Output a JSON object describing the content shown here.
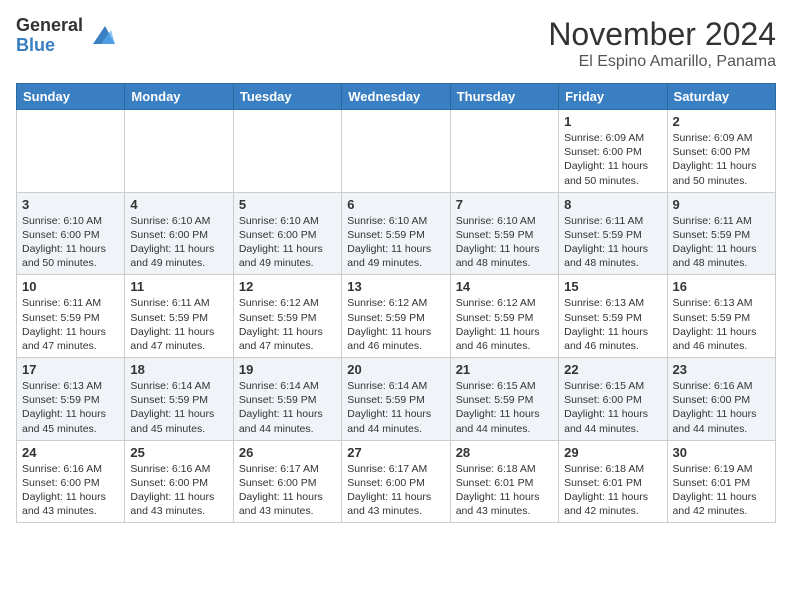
{
  "logo": {
    "general": "General",
    "blue": "Blue"
  },
  "title": "November 2024",
  "location": "El Espino Amarillo, Panama",
  "days_header": [
    "Sunday",
    "Monday",
    "Tuesday",
    "Wednesday",
    "Thursday",
    "Friday",
    "Saturday"
  ],
  "weeks": [
    [
      {
        "day": "",
        "text": ""
      },
      {
        "day": "",
        "text": ""
      },
      {
        "day": "",
        "text": ""
      },
      {
        "day": "",
        "text": ""
      },
      {
        "day": "",
        "text": ""
      },
      {
        "day": "1",
        "text": "Sunrise: 6:09 AM\nSunset: 6:00 PM\nDaylight: 11 hours\nand 50 minutes."
      },
      {
        "day": "2",
        "text": "Sunrise: 6:09 AM\nSunset: 6:00 PM\nDaylight: 11 hours\nand 50 minutes."
      }
    ],
    [
      {
        "day": "3",
        "text": "Sunrise: 6:10 AM\nSunset: 6:00 PM\nDaylight: 11 hours\nand 50 minutes."
      },
      {
        "day": "4",
        "text": "Sunrise: 6:10 AM\nSunset: 6:00 PM\nDaylight: 11 hours\nand 49 minutes."
      },
      {
        "day": "5",
        "text": "Sunrise: 6:10 AM\nSunset: 6:00 PM\nDaylight: 11 hours\nand 49 minutes."
      },
      {
        "day": "6",
        "text": "Sunrise: 6:10 AM\nSunset: 5:59 PM\nDaylight: 11 hours\nand 49 minutes."
      },
      {
        "day": "7",
        "text": "Sunrise: 6:10 AM\nSunset: 5:59 PM\nDaylight: 11 hours\nand 48 minutes."
      },
      {
        "day": "8",
        "text": "Sunrise: 6:11 AM\nSunset: 5:59 PM\nDaylight: 11 hours\nand 48 minutes."
      },
      {
        "day": "9",
        "text": "Sunrise: 6:11 AM\nSunset: 5:59 PM\nDaylight: 11 hours\nand 48 minutes."
      }
    ],
    [
      {
        "day": "10",
        "text": "Sunrise: 6:11 AM\nSunset: 5:59 PM\nDaylight: 11 hours\nand 47 minutes."
      },
      {
        "day": "11",
        "text": "Sunrise: 6:11 AM\nSunset: 5:59 PM\nDaylight: 11 hours\nand 47 minutes."
      },
      {
        "day": "12",
        "text": "Sunrise: 6:12 AM\nSunset: 5:59 PM\nDaylight: 11 hours\nand 47 minutes."
      },
      {
        "day": "13",
        "text": "Sunrise: 6:12 AM\nSunset: 5:59 PM\nDaylight: 11 hours\nand 46 minutes."
      },
      {
        "day": "14",
        "text": "Sunrise: 6:12 AM\nSunset: 5:59 PM\nDaylight: 11 hours\nand 46 minutes."
      },
      {
        "day": "15",
        "text": "Sunrise: 6:13 AM\nSunset: 5:59 PM\nDaylight: 11 hours\nand 46 minutes."
      },
      {
        "day": "16",
        "text": "Sunrise: 6:13 AM\nSunset: 5:59 PM\nDaylight: 11 hours\nand 46 minutes."
      }
    ],
    [
      {
        "day": "17",
        "text": "Sunrise: 6:13 AM\nSunset: 5:59 PM\nDaylight: 11 hours\nand 45 minutes."
      },
      {
        "day": "18",
        "text": "Sunrise: 6:14 AM\nSunset: 5:59 PM\nDaylight: 11 hours\nand 45 minutes."
      },
      {
        "day": "19",
        "text": "Sunrise: 6:14 AM\nSunset: 5:59 PM\nDaylight: 11 hours\nand 44 minutes."
      },
      {
        "day": "20",
        "text": "Sunrise: 6:14 AM\nSunset: 5:59 PM\nDaylight: 11 hours\nand 44 minutes."
      },
      {
        "day": "21",
        "text": "Sunrise: 6:15 AM\nSunset: 5:59 PM\nDaylight: 11 hours\nand 44 minutes."
      },
      {
        "day": "22",
        "text": "Sunrise: 6:15 AM\nSunset: 6:00 PM\nDaylight: 11 hours\nand 44 minutes."
      },
      {
        "day": "23",
        "text": "Sunrise: 6:16 AM\nSunset: 6:00 PM\nDaylight: 11 hours\nand 44 minutes."
      }
    ],
    [
      {
        "day": "24",
        "text": "Sunrise: 6:16 AM\nSunset: 6:00 PM\nDaylight: 11 hours\nand 43 minutes."
      },
      {
        "day": "25",
        "text": "Sunrise: 6:16 AM\nSunset: 6:00 PM\nDaylight: 11 hours\nand 43 minutes."
      },
      {
        "day": "26",
        "text": "Sunrise: 6:17 AM\nSunset: 6:00 PM\nDaylight: 11 hours\nand 43 minutes."
      },
      {
        "day": "27",
        "text": "Sunrise: 6:17 AM\nSunset: 6:00 PM\nDaylight: 11 hours\nand 43 minutes."
      },
      {
        "day": "28",
        "text": "Sunrise: 6:18 AM\nSunset: 6:01 PM\nDaylight: 11 hours\nand 43 minutes."
      },
      {
        "day": "29",
        "text": "Sunrise: 6:18 AM\nSunset: 6:01 PM\nDaylight: 11 hours\nand 42 minutes."
      },
      {
        "day": "30",
        "text": "Sunrise: 6:19 AM\nSunset: 6:01 PM\nDaylight: 11 hours\nand 42 minutes."
      }
    ]
  ]
}
